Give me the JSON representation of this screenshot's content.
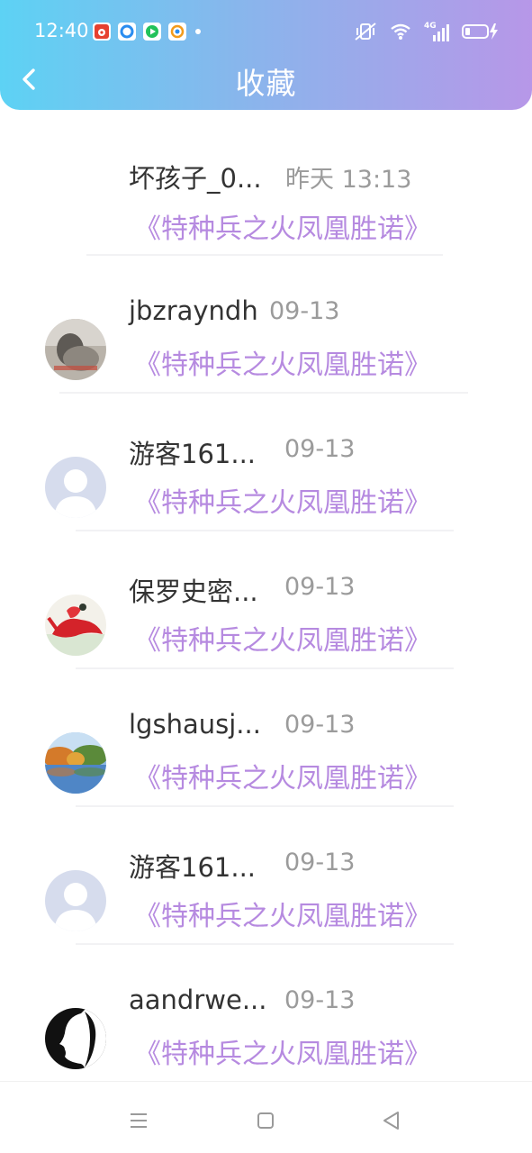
{
  "status_bar": {
    "time": "12:40",
    "network_label": "4G",
    "notification_icons": [
      "weibo-icon",
      "circle-app-icon",
      "video-play-icon",
      "browser-icon"
    ]
  },
  "header": {
    "title": "收藏",
    "accent_start": "#5dd2f4",
    "accent_end": "#b797e8"
  },
  "favorites": [
    {
      "user": "坏孩子_0...",
      "date": "昨天 13:13",
      "book": "《特种兵之火凤凰胜诺》",
      "avatar": "none"
    },
    {
      "user": "jbzrayndh",
      "date": "09-13",
      "book": "《特种兵之火凤凰胜诺》",
      "avatar": "photo-gray"
    },
    {
      "user": "游客161...",
      "date": "09-13",
      "book": "《特种兵之火凤凰胜诺》",
      "avatar": "default"
    },
    {
      "user": "保罗史密...",
      "date": "09-13",
      "book": "《特种兵之火凤凰胜诺》",
      "avatar": "red-dancer"
    },
    {
      "user": "lgshausj...",
      "date": "09-13",
      "book": "《特种兵之火凤凰胜诺》",
      "avatar": "landscape"
    },
    {
      "user": "游客161...",
      "date": "09-13",
      "book": "《特种兵之火凤凰胜诺》",
      "avatar": "default"
    },
    {
      "user": "aandrwe...",
      "date": "09-13",
      "book": "《特种兵之火凤凰胜诺》",
      "avatar": "face-silhouette"
    }
  ],
  "colors": {
    "book_title": "#b68ae0",
    "username": "#333333",
    "date": "#9b9b9b"
  },
  "nav_bar": {
    "buttons": [
      "menu-icon",
      "home-square-icon",
      "back-triangle-icon"
    ]
  }
}
